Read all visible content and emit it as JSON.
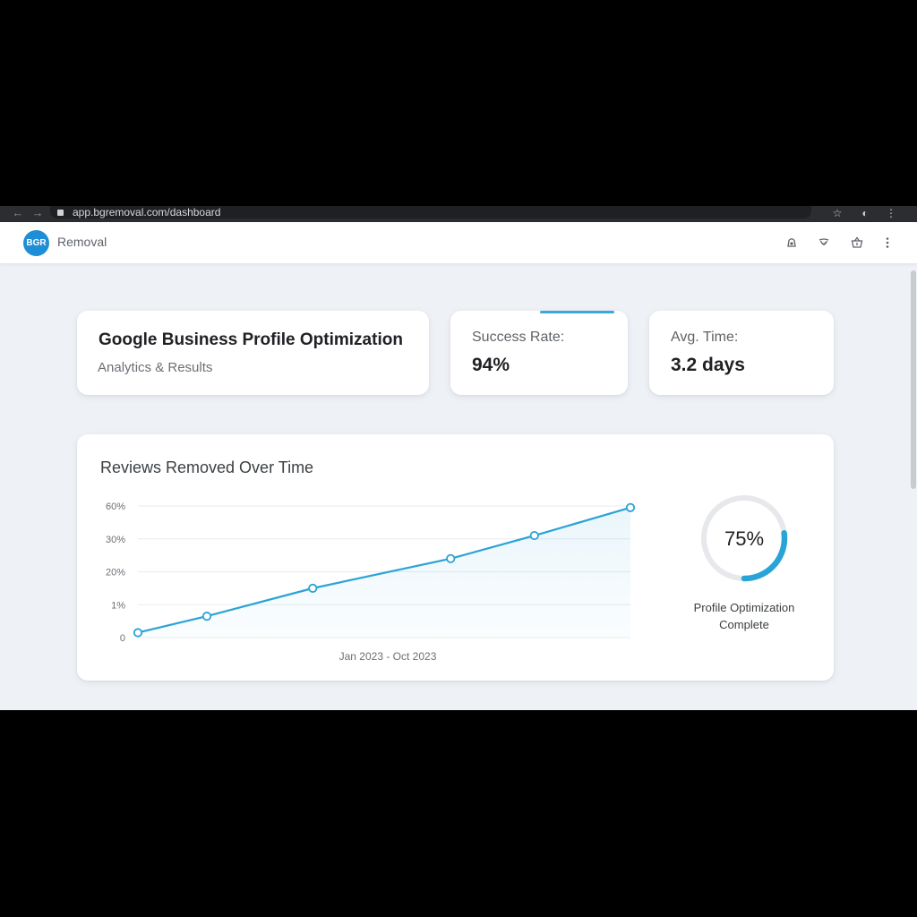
{
  "browser": {
    "url": "app.bgremoval.com/dashboard",
    "back_icon": "arrow-left-icon",
    "forward_icon": "arrow-right-icon"
  },
  "header": {
    "logo_text": "BGR",
    "brand": "Removal",
    "logo_color": "#1e8fd6"
  },
  "title_card": {
    "title": "Google Business Profile Optimization",
    "subtitle": "Analytics & Results"
  },
  "stats": [
    {
      "label": "Success Rate:",
      "value": "94%"
    },
    {
      "label": "Avg. Time:",
      "value": "3.2 days"
    }
  ],
  "progress": {
    "value_text": "75%",
    "fraction": 0.75,
    "label_line1": "Profile Optimization",
    "label_line2": "Complete",
    "color": "#2aa3d6"
  },
  "chart_data": {
    "type": "line",
    "title": "Reviews Removed Over Time",
    "xlabel": "Jan 2023 - Oct 2023",
    "ylabel": "",
    "y_ticks": [
      "0",
      "1%",
      "20%",
      "30%",
      "60%"
    ],
    "points": [
      0.15,
      0.65,
      1.5,
      2.4,
      3.1,
      3.95
    ],
    "x_positions": [
      0,
      0.14,
      0.355,
      0.635,
      0.805,
      1.0
    ],
    "grid": true,
    "line_color": "#2aa3d6"
  }
}
